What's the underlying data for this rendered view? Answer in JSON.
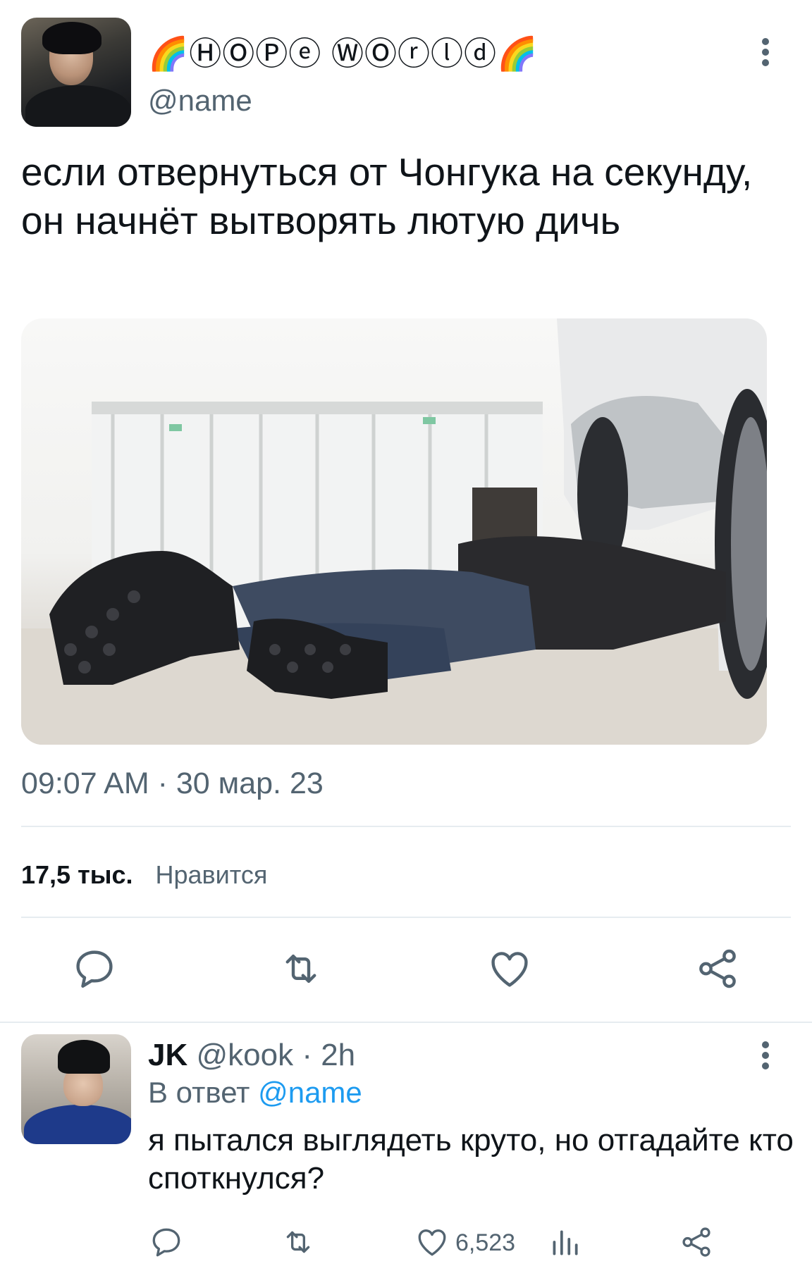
{
  "tweet": {
    "display_name": "🌈ⒽⓄⓅⓔ ⓌⓄⓡⓛⓓ🌈",
    "handle": "@name",
    "text": "если отвернуться от Чонгука на секунду,  он начнёт вытворять лютую дичь",
    "timestamp": "09:07 AM · 30 мар. 23",
    "likes_count": "17,5 тыс.",
    "likes_label": "Нравится",
    "actions": [
      "comment-icon",
      "retweet-icon",
      "heart-icon",
      "share-icon"
    ]
  },
  "reply": {
    "name": "JK",
    "meta": "@kook · 2h",
    "reply_prefix": "В ответ",
    "reply_mention": "@name",
    "text": "я пытался выглядеть круто, но отгадайте кто споткнулся?",
    "likes": "6,523",
    "actions": [
      "comment-icon",
      "retweet-icon",
      "heart-icon",
      "analytics-icon",
      "share-icon"
    ]
  },
  "colors": {
    "text_primary": "#0f1419",
    "text_secondary": "#536471",
    "accent_link": "#1d9bf0",
    "divider": "#e6ecf0"
  }
}
